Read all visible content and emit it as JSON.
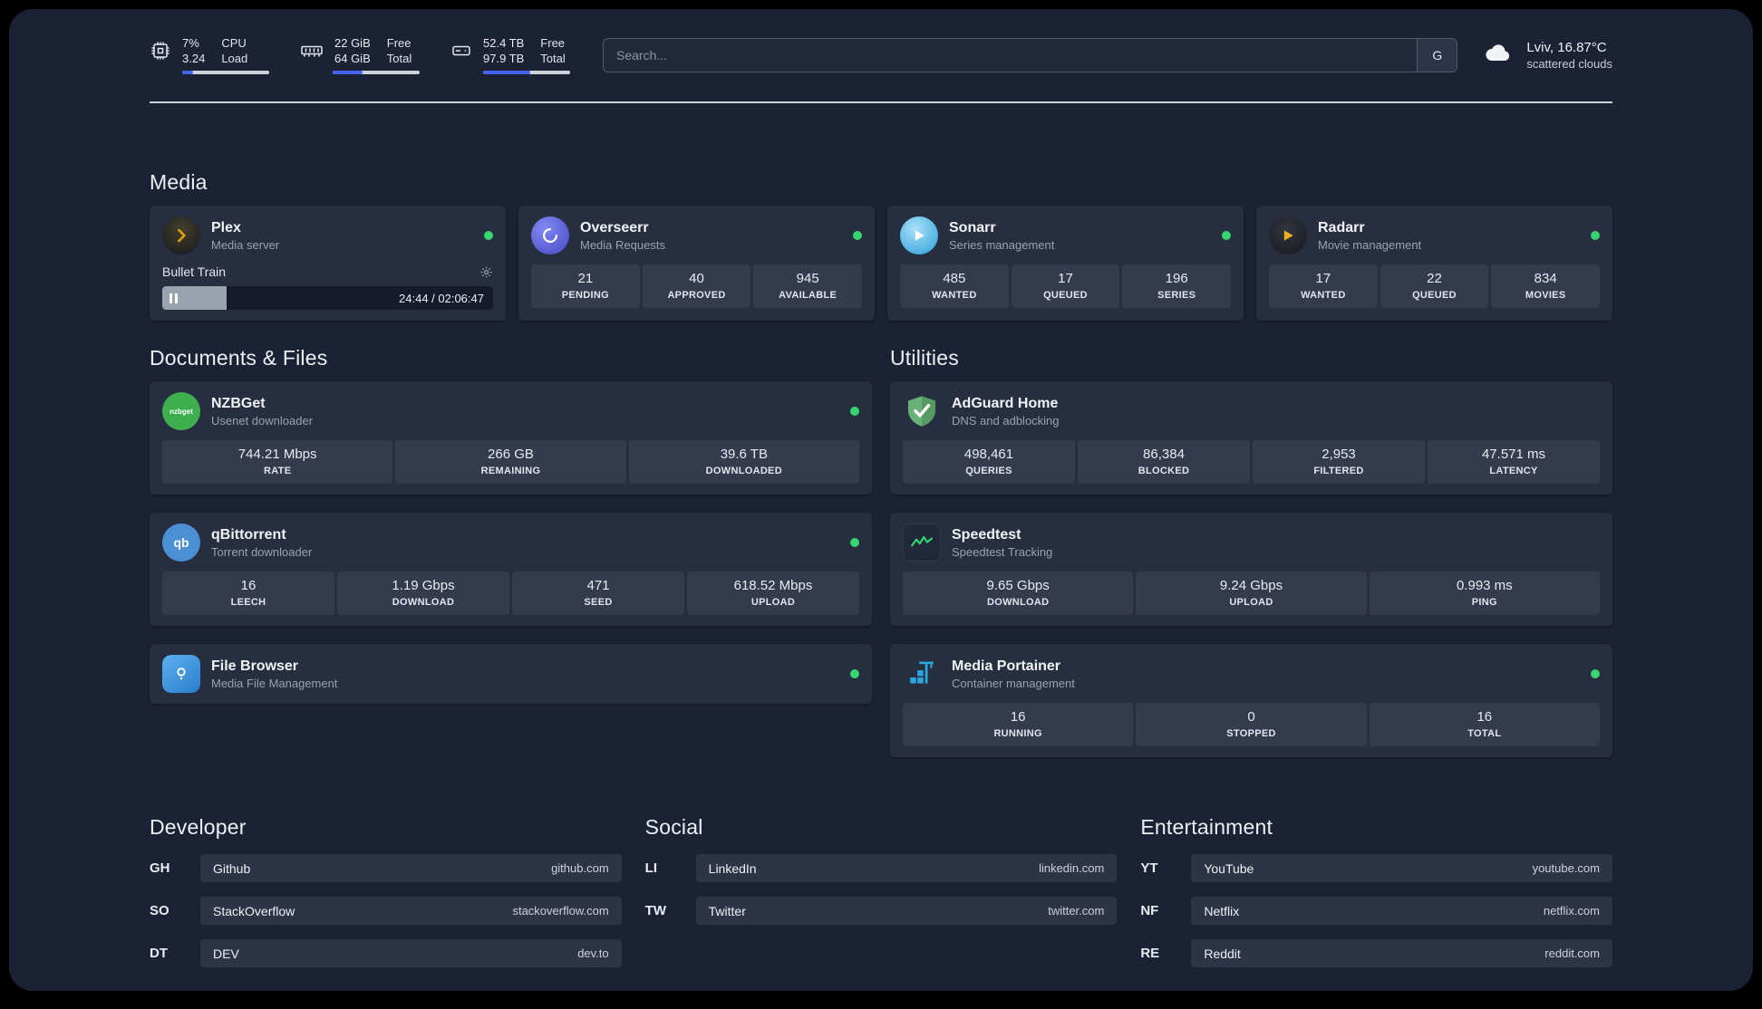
{
  "colors": {
    "status_online": "#37d46f",
    "accent_blue": "#4263eb",
    "background": "#1b2234",
    "card": "#272e3f",
    "tile": "#343b4d"
  },
  "topbar": {
    "cpu": {
      "value1": "7%",
      "value2": "3.24",
      "label1": "CPU",
      "label2": "Load",
      "bar_percent": 12
    },
    "memory": {
      "value1": "22 GiB",
      "value2": "64 GiB",
      "label1": "Free",
      "label2": "Total",
      "bar_percent": 34
    },
    "storage": {
      "value1": "52.4 TB",
      "value2": "97.9 TB",
      "label1": "Free",
      "label2": "Total",
      "bar_percent": 54
    },
    "search_placeholder": "Search...",
    "search_button": "G",
    "weather": {
      "location": "Lviv, 16.87°C",
      "condition": "scattered clouds"
    }
  },
  "media_section": {
    "title": "Media",
    "plex": {
      "name": "Plex",
      "desc": "Media server",
      "now_playing": "Bullet Train",
      "time": "24:44 / 02:06:47",
      "progress_percent": 19.5
    },
    "overseerr": {
      "name": "Overseerr",
      "desc": "Media Requests",
      "stats": [
        {
          "value": "21",
          "label": "PENDING"
        },
        {
          "value": "40",
          "label": "APPROVED"
        },
        {
          "value": "945",
          "label": "AVAILABLE"
        }
      ]
    },
    "sonarr": {
      "name": "Sonarr",
      "desc": "Series management",
      "stats": [
        {
          "value": "485",
          "label": "WANTED"
        },
        {
          "value": "17",
          "label": "QUEUED"
        },
        {
          "value": "196",
          "label": "SERIES"
        }
      ]
    },
    "radarr": {
      "name": "Radarr",
      "desc": "Movie management",
      "stats": [
        {
          "value": "17",
          "label": "WANTED"
        },
        {
          "value": "22",
          "label": "QUEUED"
        },
        {
          "value": "834",
          "label": "MOVIES"
        }
      ]
    }
  },
  "documents_section": {
    "title": "Documents & Files",
    "nzbget": {
      "name": "NZBGet",
      "desc": "Usenet downloader",
      "icon_text": "nzbget",
      "stats": [
        {
          "value": "744.21 Mbps",
          "label": "RATE"
        },
        {
          "value": "266 GB",
          "label": "REMAINING"
        },
        {
          "value": "39.6 TB",
          "label": "DOWNLOADED"
        }
      ]
    },
    "qbittorrent": {
      "name": "qBittorrent",
      "desc": "Torrent downloader",
      "icon_text": "qb",
      "stats": [
        {
          "value": "16",
          "label": "LEECH"
        },
        {
          "value": "1.19 Gbps",
          "label": "DOWNLOAD"
        },
        {
          "value": "471",
          "label": "SEED"
        },
        {
          "value": "618.52 Mbps",
          "label": "UPLOAD"
        }
      ]
    },
    "filebrowser": {
      "name": "File Browser",
      "desc": "Media File Management"
    }
  },
  "utilities_section": {
    "title": "Utilities",
    "adguard": {
      "name": "AdGuard Home",
      "desc": "DNS and adblocking",
      "stats": [
        {
          "value": "498,461",
          "label": "QUERIES"
        },
        {
          "value": "86,384",
          "label": "BLOCKED"
        },
        {
          "value": "2,953",
          "label": "FILTERED"
        },
        {
          "value": "47.571 ms",
          "label": "LATENCY"
        }
      ]
    },
    "speedtest": {
      "name": "Speedtest",
      "desc": "Speedtest Tracking",
      "stats": [
        {
          "value": "9.65 Gbps",
          "label": "DOWNLOAD"
        },
        {
          "value": "9.24 Gbps",
          "label": "UPLOAD"
        },
        {
          "value": "0.993 ms",
          "label": "PING"
        }
      ]
    },
    "portainer": {
      "name": "Media Portainer",
      "desc": "Container management",
      "stats": [
        {
          "value": "16",
          "label": "RUNNING"
        },
        {
          "value": "0",
          "label": "STOPPED"
        },
        {
          "value": "16",
          "label": "TOTAL"
        }
      ]
    }
  },
  "bookmarks": {
    "developer": {
      "title": "Developer",
      "items": [
        {
          "abbr": "GH",
          "name": "Github",
          "url": "github.com"
        },
        {
          "abbr": "SO",
          "name": "StackOverflow",
          "url": "stackoverflow.com"
        },
        {
          "abbr": "DT",
          "name": "DEV",
          "url": "dev.to"
        }
      ]
    },
    "social": {
      "title": "Social",
      "items": [
        {
          "abbr": "LI",
          "name": "LinkedIn",
          "url": "linkedin.com"
        },
        {
          "abbr": "TW",
          "name": "Twitter",
          "url": "twitter.com"
        }
      ]
    },
    "entertainment": {
      "title": "Entertainment",
      "items": [
        {
          "abbr": "YT",
          "name": "YouTube",
          "url": "youtube.com"
        },
        {
          "abbr": "NF",
          "name": "Netflix",
          "url": "netflix.com"
        },
        {
          "abbr": "RE",
          "name": "Reddit",
          "url": "reddit.com"
        }
      ]
    }
  }
}
